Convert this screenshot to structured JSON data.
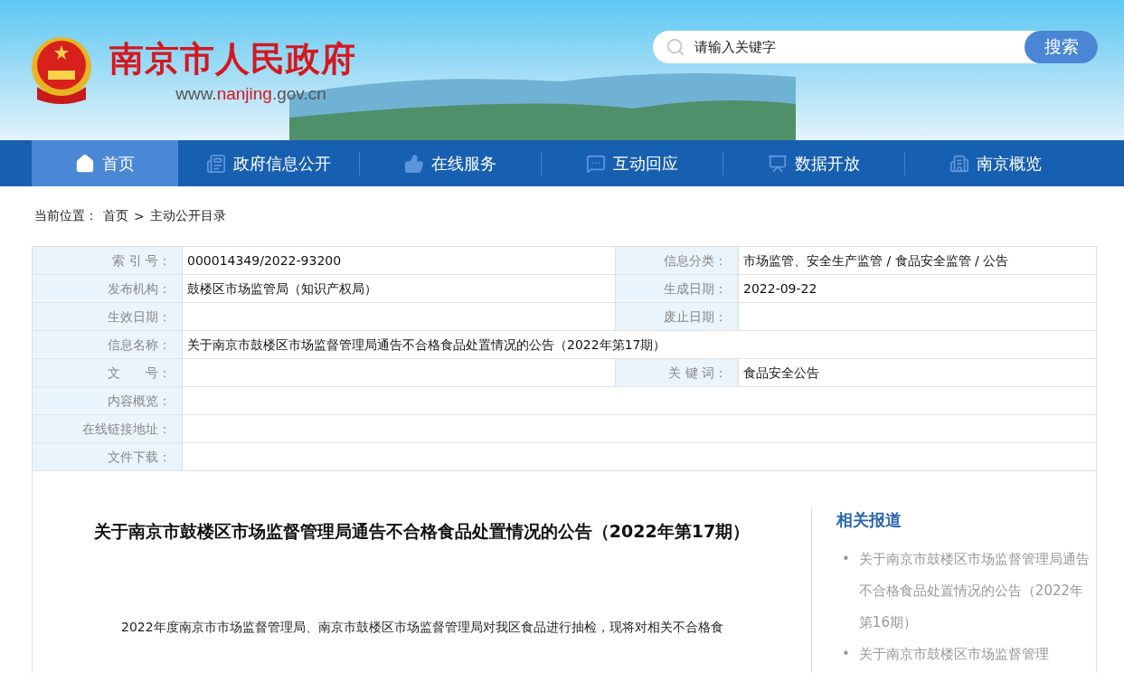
{
  "header": {
    "site_name": "南京市人民政府",
    "url": "www.**nanjing**.gov.cn",
    "search": {
      "placeholder": "请输入关键字",
      "button": "搜索"
    }
  },
  "nav": [
    {
      "label": "首页",
      "selected": true
    },
    {
      "label": "政府信息公开",
      "selected": false
    },
    {
      "label": "在线服务",
      "selected": false
    },
    {
      "label": "互动回应",
      "selected": false
    },
    {
      "label": "数据开放",
      "selected": false
    },
    {
      "label": "南京概览",
      "selected": false
    }
  ],
  "breadcrumb": {
    "label": "当前位置：",
    "items": [
      "首页",
      "主动公开目录"
    ],
    "separator": ">"
  },
  "info_table": [
    {
      "cells": [
        {
          "label": "索 引 号：",
          "value": "000014349/2022-93200"
        },
        {
          "label": "信息分类：",
          "value": "市场监管、安全生产监管 / 食品安全监管 / 公告"
        }
      ]
    },
    {
      "cells": [
        {
          "label": "发布机构：",
          "value": "鼓楼区市场监管局（知识产权局）"
        },
        {
          "label": "生成日期：",
          "value": "2022-09-22"
        }
      ]
    },
    {
      "cells": [
        {
          "label": "生效日期："
        },
        {
          "label": "废止日期："
        }
      ]
    },
    {
      "cells": [
        {
          "label": "信息名称：",
          "value": "关于南京市鼓楼区市场监督管理局通告不合格食品处置情况的公告（2022年第17期）"
        }
      ]
    },
    {
      "cells": [
        {
          "label": "文　　号："
        },
        {
          "label": "关 键 词：",
          "value": "食品安全公告"
        }
      ]
    },
    {
      "cells": [
        {
          "label": "内容概览："
        }
      ]
    },
    {
      "cells": [
        {
          "label": "在线链接地址："
        }
      ]
    },
    {
      "cells": [
        {
          "label": "文件下载："
        }
      ]
    }
  ],
  "article": {
    "title": "关于南京市鼓楼区市场监督管理局通告不合格食品处置情况的公告（2022年第17期）",
    "paragraphs": [
      "2022年度南京市市场监督管理局、南京市鼓楼区市场监督管理局对我区食品进行抽检，现将对相关不合格食"
    ]
  },
  "related": {
    "title": "相关报道",
    "marker": "•",
    "items": [
      "关于南京市鼓楼区市场监督管理局通告不合格食品处置情况的公告（2022年第16期）",
      "关于南京市鼓楼区市场监督管理"
    ]
  }
}
